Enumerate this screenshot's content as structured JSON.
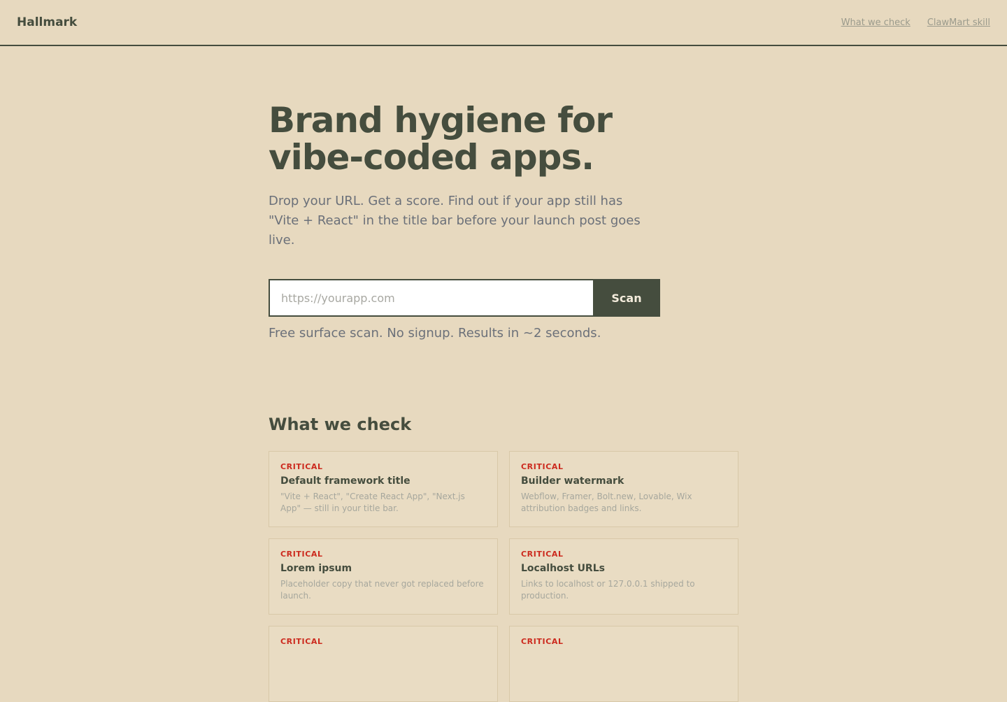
{
  "header": {
    "brand": "Hallmark",
    "nav": [
      {
        "label": "What we check"
      },
      {
        "label": "ClawMart skill"
      }
    ]
  },
  "hero": {
    "title": "Brand hygiene for vibe-coded apps.",
    "subtitle": "Drop your URL. Get a score. Find out if your app still has \"Vite + React\" in the title bar before your launch post goes live.",
    "input_placeholder": "https://yourapp.com",
    "input_value": "",
    "scan_label": "Scan",
    "note": "Free surface scan. No signup. Results in ~2 seconds."
  },
  "checks": {
    "title": "What we check",
    "items": [
      {
        "severity": "CRITICAL",
        "title": "Default framework title",
        "description": "\"Vite + React\", \"Create React App\", \"Next.js App\" — still in your title bar."
      },
      {
        "severity": "CRITICAL",
        "title": "Builder watermark",
        "description": "Webflow, Framer, Bolt.new, Lovable, Wix attribution badges and links."
      },
      {
        "severity": "CRITICAL",
        "title": "Lorem ipsum",
        "description": "Placeholder copy that never got replaced before launch."
      },
      {
        "severity": "CRITICAL",
        "title": "Localhost URLs",
        "description": "Links to localhost or 127.0.0.1 shipped to production."
      },
      {
        "severity": "CRITICAL",
        "title": "",
        "description": ""
      },
      {
        "severity": "CRITICAL",
        "title": "",
        "description": ""
      }
    ]
  },
  "colors": {
    "background": "#e7d9bf",
    "ink": "#454d3e",
    "muted": "#6b7079",
    "critical": "#cc2a1e"
  }
}
